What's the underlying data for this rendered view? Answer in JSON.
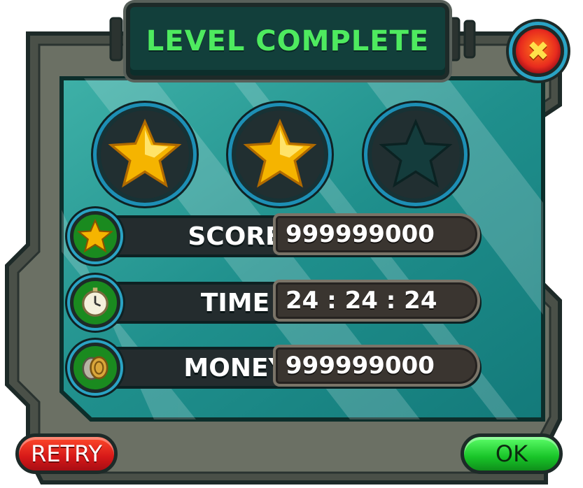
{
  "title": "LEVEL COMPLETE",
  "close_icon": "close-icon",
  "stars": {
    "earned": 2,
    "total": 3
  },
  "stats": [
    {
      "label": "SCORE",
      "value": "999999000",
      "icon": "star-icon"
    },
    {
      "label": "TIME",
      "value": "24 : 24 : 24",
      "icon": "clock-icon"
    },
    {
      "label": "MONEY",
      "value": "999999000",
      "icon": "coins-icon"
    }
  ],
  "buttons": {
    "retry": "RETRY",
    "ok": "OK"
  },
  "colors": {
    "title_green": "#4eea5f",
    "panel_teal": "#1f8f8c",
    "retry_red": "#d61818",
    "ok_green": "#18c428"
  }
}
